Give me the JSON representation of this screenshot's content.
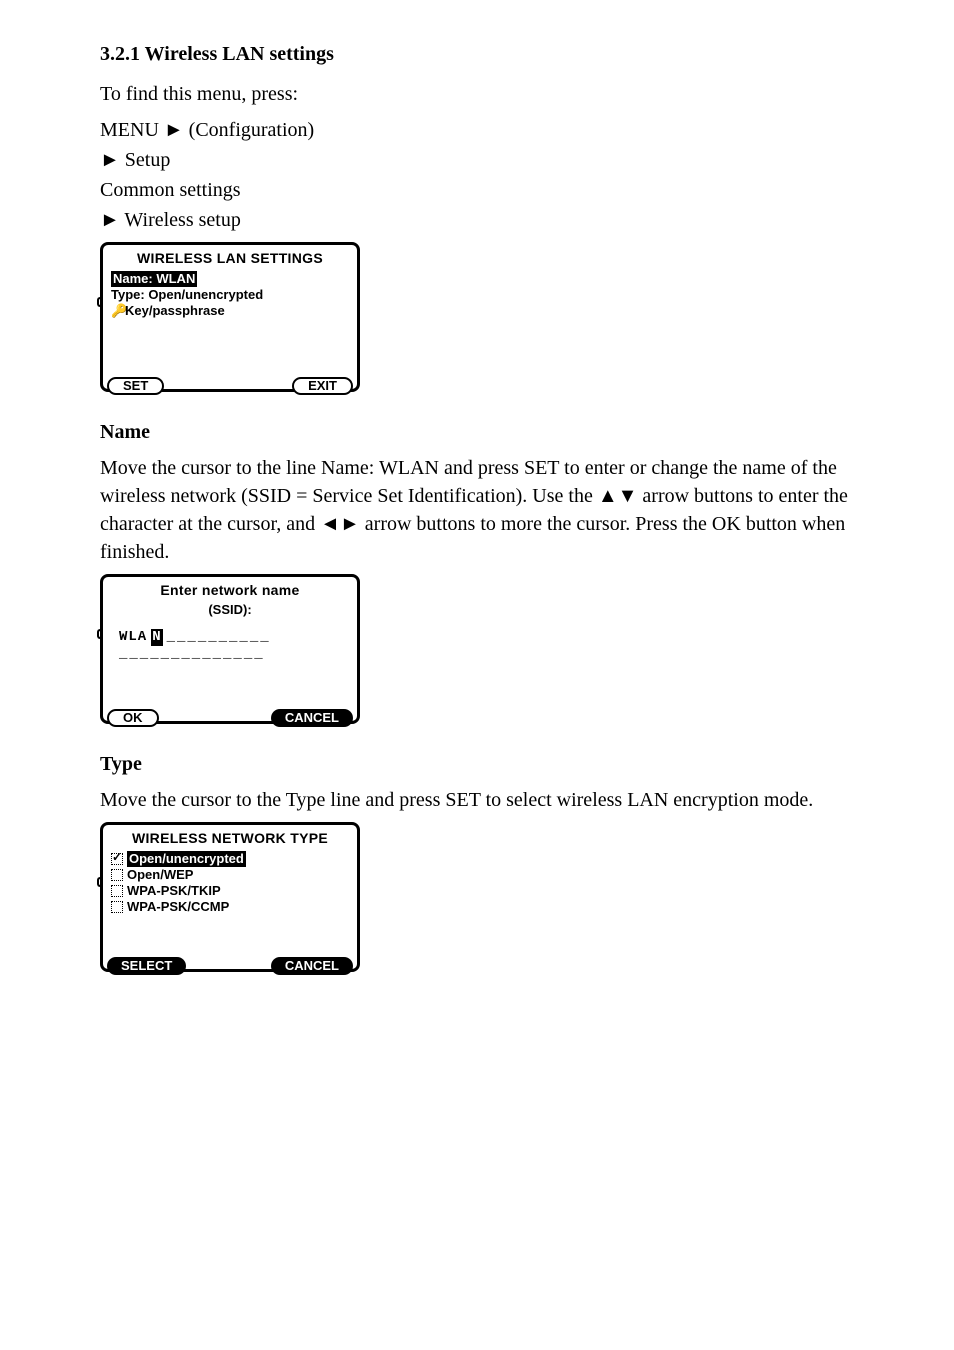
{
  "section": {
    "title": "3.2.1 Wireless LAN settings",
    "intro": "To find this menu, press:",
    "steps": [
      "MENU ► (Configuration)",
      "  ► Setup",
      "    Common settings",
      "  ► Wireless setup"
    ],
    "after_steps": "Move the cursor to the line Name: WLAN and press SET to enter or change the name of the wireless network (SSID = Service Set Identification). Use the ▲▼ arrow buttons to enter the character at the cursor, and  ◄►  arrow buttons to more the cursor. Press the OK button when finished.",
    "type_intro": "Move the cursor to the Type line and press SET to select wireless LAN encryption mode."
  },
  "lcd1": {
    "title": "WIRELESS LAN SETTINGS",
    "rows": {
      "name": "Name: WLAN",
      "type": "Type: Open/unencrypted",
      "key": "Key/passphrase"
    },
    "btn_left": "SET",
    "btn_right": "EXIT"
  },
  "lcd2": {
    "title1": "Enter network name",
    "title2": "(SSID):",
    "prefix": "WLA",
    "cursor": "N",
    "dashes1": "__________",
    "dashes2": "______________",
    "btn_left": "OK",
    "btn_right": "CANCEL"
  },
  "lcd3": {
    "title": "WIRELESS NETWORK TYPE",
    "opt1": "Open/unencrypted",
    "opt2": "Open/WEP",
    "opt3": "WPA-PSK/TKIP",
    "opt4": "WPA-PSK/CCMP",
    "btn_left": "SELECT",
    "btn_right": "CANCEL"
  },
  "subheads": {
    "name": "Name",
    "type": "Type"
  }
}
